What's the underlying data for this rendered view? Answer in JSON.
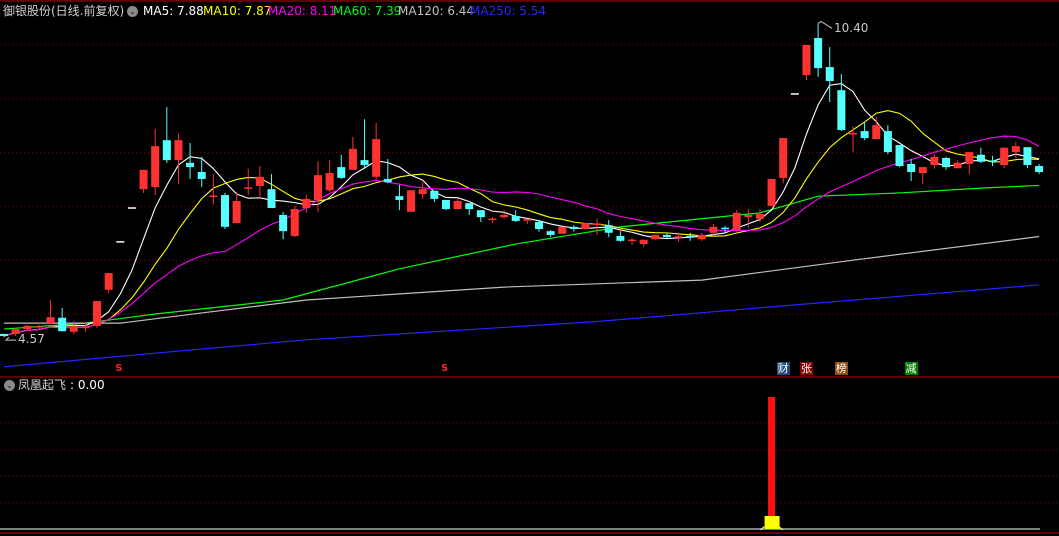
{
  "header": {
    "stock_title": "御银股份(日线.前复权)",
    "ma": [
      {
        "label": "MA5: 7.88",
        "period": 5,
        "color": "#ffffff"
      },
      {
        "label": "MA10: 7.87",
        "period": 10,
        "color": "#ffff00"
      },
      {
        "label": "MA20: 8.11",
        "period": 20,
        "color": "#ff00ff"
      },
      {
        "label": "MA60: 7.39",
        "period": 60,
        "color": "#00ff00"
      },
      {
        "label": "MA120: 6.44",
        "period": 120,
        "color": "#c0c0c0"
      },
      {
        "label": "MA250: 5.54",
        "period": 250,
        "color": "#2626ff"
      }
    ]
  },
  "price_marks": {
    "high_label": "10.40",
    "low_label": "4.57",
    "high_index": 70,
    "low_index": 0
  },
  "colors": {
    "up": "#ff3232",
    "down": "#54ffff",
    "flat": "#ffffff",
    "grid": "#8b0000",
    "divider": "#c00000"
  },
  "chart_data": {
    "type": "candlestick",
    "price_grid": [
      10,
      9,
      8,
      7,
      6,
      5
    ],
    "ohlc": [
      [
        4.63,
        4.63,
        4.57,
        4.59
      ],
      [
        4.63,
        4.74,
        4.59,
        4.72
      ],
      [
        4.72,
        4.8,
        4.68,
        4.78
      ],
      [
        4.76,
        4.8,
        4.72,
        4.76
      ],
      [
        4.83,
        5.26,
        4.83,
        4.94
      ],
      [
        4.93,
        5.11,
        4.68,
        4.68
      ],
      [
        4.67,
        4.87,
        4.63,
        4.78
      ],
      [
        4.74,
        4.85,
        4.67,
        4.75
      ],
      [
        4.78,
        5.24,
        4.74,
        5.24
      ],
      [
        5.45,
        5.76,
        5.39,
        5.76
      ],
      [
        6.34,
        6.34,
        6.34,
        6.34
      ],
      [
        6.97,
        6.97,
        6.97,
        6.97
      ],
      [
        7.32,
        7.68,
        7.25,
        7.68
      ],
      [
        7.36,
        8.44,
        7.21,
        8.12
      ],
      [
        8.23,
        8.85,
        7.81,
        7.86
      ],
      [
        7.86,
        8.35,
        7.42,
        8.23
      ],
      [
        7.81,
        8.18,
        7.51,
        7.73
      ],
      [
        7.64,
        7.92,
        7.36,
        7.51
      ],
      [
        7.19,
        7.6,
        7.04,
        7.19
      ],
      [
        7.21,
        7.25,
        6.58,
        6.62
      ],
      [
        6.69,
        7.27,
        6.69,
        7.1
      ],
      [
        7.33,
        7.7,
        7.21,
        7.34
      ],
      [
        7.38,
        7.75,
        7.14,
        7.55
      ],
      [
        7.32,
        7.6,
        6.97,
        6.97
      ],
      [
        6.84,
        6.9,
        6.39,
        6.54
      ],
      [
        6.45,
        7.01,
        6.43,
        6.95
      ],
      [
        6.97,
        7.21,
        6.88,
        7.14
      ],
      [
        7.12,
        7.84,
        6.9,
        7.58
      ],
      [
        7.3,
        7.86,
        7.27,
        7.62
      ],
      [
        7.73,
        7.96,
        7.51,
        7.53
      ],
      [
        7.68,
        8.29,
        7.68,
        8.07
      ],
      [
        7.86,
        8.62,
        7.71,
        7.77
      ],
      [
        7.55,
        8.55,
        7.49,
        8.25
      ],
      [
        7.51,
        7.88,
        7.43,
        7.45
      ],
      [
        7.19,
        7.4,
        6.93,
        7.12
      ],
      [
        6.9,
        7.3,
        6.9,
        7.3
      ],
      [
        7.23,
        7.45,
        7.14,
        7.32
      ],
      [
        7.29,
        7.29,
        7.08,
        7.14
      ],
      [
        7.12,
        7.12,
        6.93,
        6.95
      ],
      [
        6.95,
        7.16,
        6.95,
        7.1
      ],
      [
        7.06,
        7.06,
        6.84,
        6.95
      ],
      [
        6.93,
        6.93,
        6.71,
        6.8
      ],
      [
        6.75,
        6.8,
        6.69,
        6.76
      ],
      [
        6.8,
        6.93,
        6.77,
        6.84
      ],
      [
        6.82,
        6.93,
        6.71,
        6.73
      ],
      [
        6.75,
        6.77,
        6.67,
        6.75
      ],
      [
        6.71,
        6.75,
        6.53,
        6.58
      ],
      [
        6.54,
        6.56,
        6.43,
        6.47
      ],
      [
        6.49,
        6.62,
        6.49,
        6.62
      ],
      [
        6.62,
        6.65,
        6.53,
        6.58
      ],
      [
        6.58,
        6.69,
        6.58,
        6.69
      ],
      [
        6.65,
        6.77,
        6.47,
        6.67
      ],
      [
        6.65,
        6.75,
        6.43,
        6.51
      ],
      [
        6.45,
        6.54,
        6.34,
        6.36
      ],
      [
        6.36,
        6.41,
        6.28,
        6.37
      ],
      [
        6.3,
        6.38,
        6.25,
        6.38
      ],
      [
        6.39,
        6.47,
        6.38,
        6.47
      ],
      [
        6.47,
        6.51,
        6.41,
        6.43
      ],
      [
        6.43,
        6.51,
        6.34,
        6.43
      ],
      [
        6.44,
        6.51,
        6.36,
        6.43
      ],
      [
        6.39,
        6.51,
        6.36,
        6.47
      ],
      [
        6.51,
        6.67,
        6.47,
        6.62
      ],
      [
        6.59,
        6.64,
        6.51,
        6.58
      ],
      [
        6.56,
        6.93,
        6.53,
        6.88
      ],
      [
        6.8,
        6.95,
        6.6,
        6.84
      ],
      [
        6.77,
        6.95,
        6.71,
        6.86
      ],
      [
        7.01,
        7.51,
        7.01,
        7.51
      ],
      [
        7.53,
        8.27,
        7.43,
        8.27
      ],
      [
        9.09,
        9.09,
        9.09,
        9.09
      ],
      [
        9.44,
        10.0,
        9.35,
        10.0
      ],
      [
        10.13,
        10.4,
        9.41,
        9.57
      ],
      [
        9.59,
        9.96,
        8.94,
        9.33
      ],
      [
        9.16,
        9.46,
        8.4,
        8.42
      ],
      [
        8.34,
        8.49,
        8.01,
        8.35
      ],
      [
        8.4,
        8.57,
        8.23,
        8.27
      ],
      [
        8.25,
        8.66,
        8.25,
        8.51
      ],
      [
        8.4,
        8.51,
        7.97,
        8.01
      ],
      [
        8.14,
        8.14,
        7.73,
        7.75
      ],
      [
        7.79,
        7.88,
        7.47,
        7.64
      ],
      [
        7.62,
        7.73,
        7.42,
        7.73
      ],
      [
        7.77,
        7.97,
        7.7,
        7.92
      ],
      [
        7.9,
        7.92,
        7.68,
        7.73
      ],
      [
        7.71,
        7.86,
        7.71,
        7.81
      ],
      [
        7.79,
        8.01,
        7.6,
        8.01
      ],
      [
        7.96,
        8.09,
        7.81,
        7.83
      ],
      [
        7.84,
        7.94,
        7.75,
        7.81
      ],
      [
        7.77,
        8.1,
        7.71,
        8.09
      ],
      [
        8.01,
        8.2,
        7.9,
        8.12
      ],
      [
        8.1,
        8.1,
        7.71,
        7.77
      ],
      [
        7.75,
        7.79,
        7.6,
        7.64
      ]
    ],
    "long_ma_anchors": {
      "MA60": [
        [
          0,
          4.72
        ],
        [
          7,
          4.83
        ],
        [
          13,
          5.0
        ],
        [
          24,
          5.26
        ],
        [
          34,
          5.84
        ],
        [
          44,
          6.3
        ],
        [
          53,
          6.62
        ],
        [
          65,
          6.88
        ],
        [
          70,
          7.19
        ],
        [
          77,
          7.25
        ],
        [
          84,
          7.34
        ],
        [
          89,
          7.39
        ]
      ],
      "MA120": [
        [
          0,
          4.83
        ],
        [
          10,
          4.83
        ],
        [
          17,
          5.02
        ],
        [
          26,
          5.26
        ],
        [
          43,
          5.5
        ],
        [
          60,
          5.63
        ],
        [
          73,
          6.0
        ],
        [
          89,
          6.44
        ]
      ],
      "MA250": [
        [
          0,
          4.02
        ],
        [
          16,
          4.33
        ],
        [
          26,
          4.52
        ],
        [
          51,
          4.86
        ],
        [
          68,
          5.17
        ],
        [
          89,
          5.54
        ]
      ]
    }
  },
  "events": [
    {
      "label": "财",
      "day_index": 66,
      "bg": "#1e4a7e"
    },
    {
      "label": "张",
      "day_index": 68,
      "bg": "#8b0000"
    },
    {
      "label": "榜",
      "day_index": 71,
      "bg": "#8b4a10"
    },
    {
      "label": "减",
      "day_index": 77,
      "bg": "#008000"
    }
  ],
  "s_markers": [
    {
      "label": "S",
      "day_index": 10
    },
    {
      "label": "S",
      "day_index": 38
    }
  ],
  "indicator": {
    "title": "凤凰起飞",
    "value_label": ": 0.00",
    "signal_day_index": 66,
    "signal_value": 1
  }
}
